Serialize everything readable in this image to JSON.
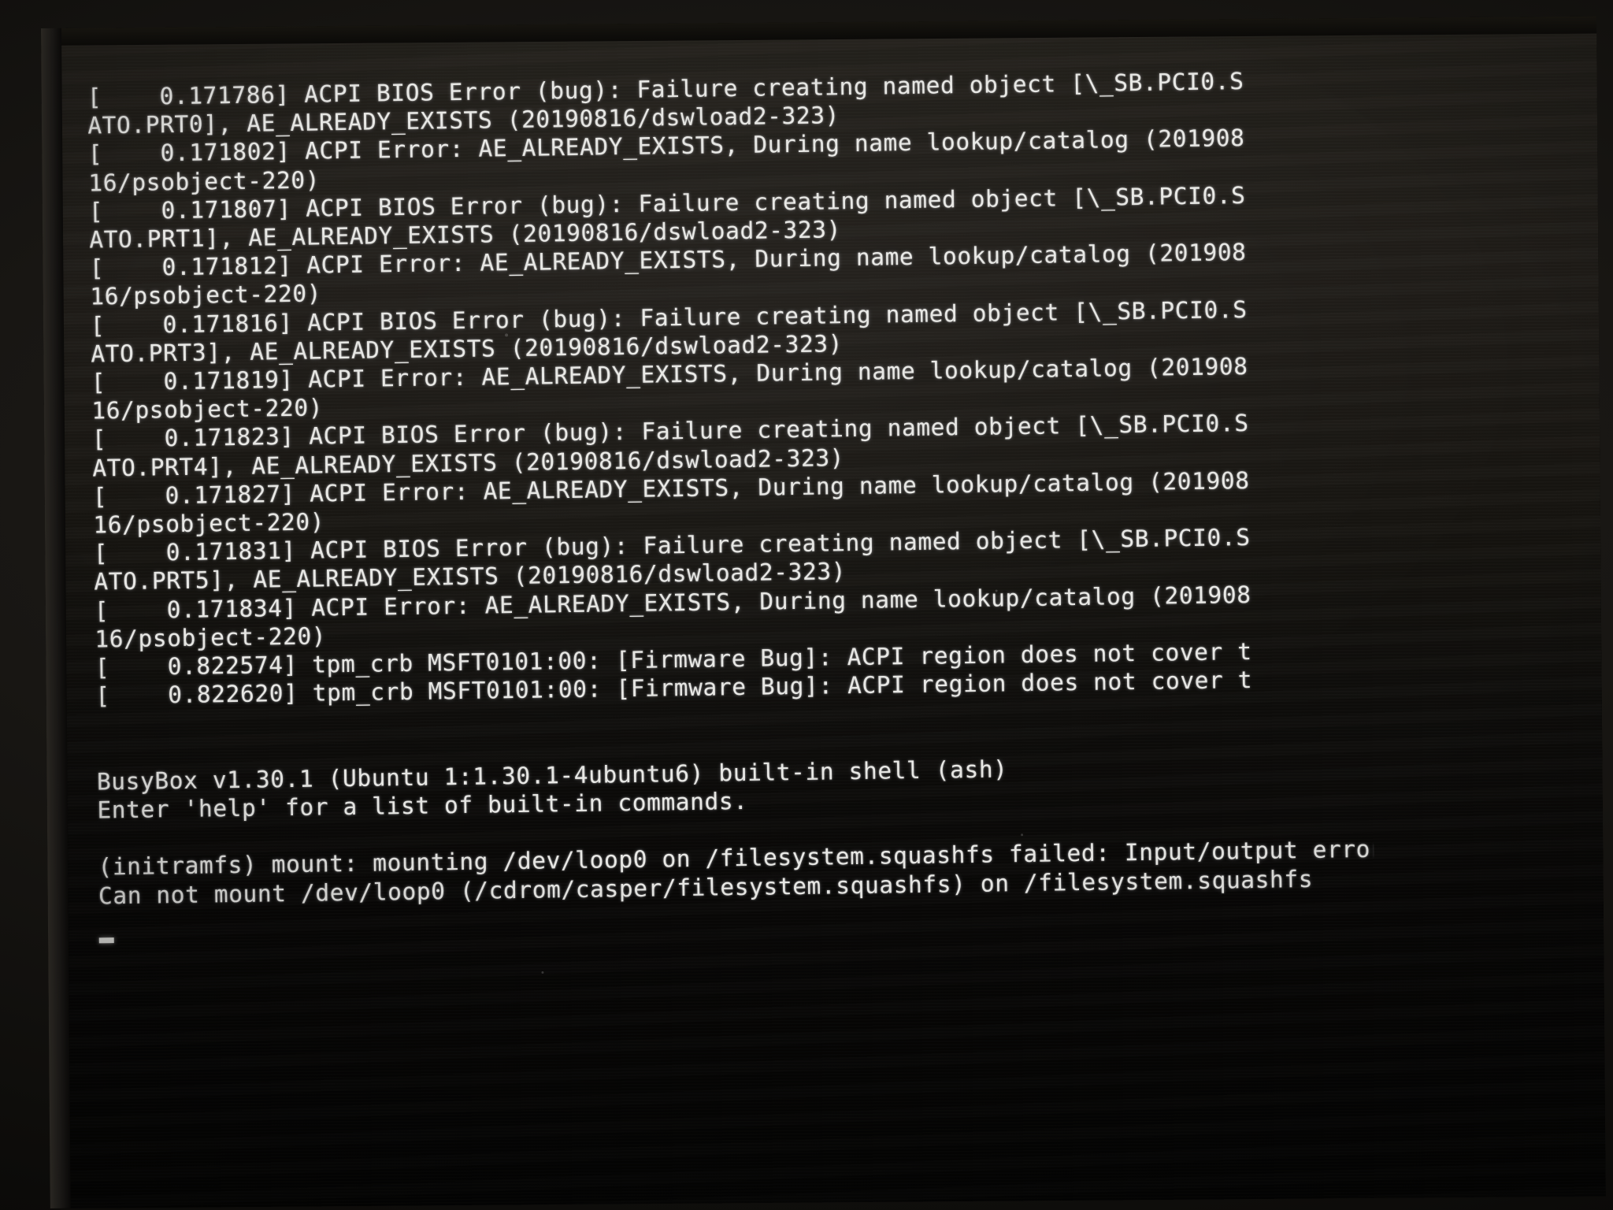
{
  "screen": {
    "type": "linux-boot-console",
    "background_color": "#0b0a08",
    "text_color": "#e9e9e6",
    "cursor_glyph": "_"
  },
  "console": {
    "lines": [
      "[    0.171786] ACPI BIOS Error (bug): Failure creating named object [\\_SB.PCI0.S",
      "ATO.PRT0], AE_ALREADY_EXISTS (20190816/dswload2-323)",
      "[    0.171802] ACPI Error: AE_ALREADY_EXISTS, During name lookup/catalog (201908",
      "16/psobject-220)",
      "[    0.171807] ACPI BIOS Error (bug): Failure creating named object [\\_SB.PCI0.S",
      "ATO.PRT1], AE_ALREADY_EXISTS (20190816/dswload2-323)",
      "[    0.171812] ACPI Error: AE_ALREADY_EXISTS, During name lookup/catalog (201908",
      "16/psobject-220)",
      "[    0.171816] ACPI BIOS Error (bug): Failure creating named object [\\_SB.PCI0.S",
      "ATO.PRT3], AE_ALREADY_EXISTS (20190816/dswload2-323)",
      "[    0.171819] ACPI Error: AE_ALREADY_EXISTS, During name lookup/catalog (201908",
      "16/psobject-220)",
      "[    0.171823] ACPI BIOS Error (bug): Failure creating named object [\\_SB.PCI0.S",
      "ATO.PRT4], AE_ALREADY_EXISTS (20190816/dswload2-323)",
      "[    0.171827] ACPI Error: AE_ALREADY_EXISTS, During name lookup/catalog (201908",
      "16/psobject-220)",
      "[    0.171831] ACPI BIOS Error (bug): Failure creating named object [\\_SB.PCI0.S",
      "ATO.PRT5], AE_ALREADY_EXISTS (20190816/dswload2-323)",
      "[    0.171834] ACPI Error: AE_ALREADY_EXISTS, During name lookup/catalog (201908",
      "16/psobject-220)",
      "[    0.822574] tpm_crb MSFT0101:00: [Firmware Bug]: ACPI region does not cover t",
      "[    0.822620] tpm_crb MSFT0101:00: [Firmware Bug]: ACPI region does not cover t",
      "",
      "",
      "BusyBox v1.30.1 (Ubuntu 1:1.30.1-4ubuntu6) built-in shell (ash)",
      "Enter 'help' for a list of built-in commands.",
      "",
      "(initramfs) mount: mounting /dev/loop0 on /filesystem.squashfs failed: Input/output error",
      "Can not mount /dev/loop0 (/cdrom/casper/filesystem.squashfs) on /filesystem.squashfs"
    ]
  },
  "details": {
    "kernel_timestamps": [
      "0.171786",
      "0.171802",
      "0.171807",
      "0.171812",
      "0.171816",
      "0.171819",
      "0.171823",
      "0.171827",
      "0.171831",
      "0.171834",
      "0.822574",
      "0.822620"
    ],
    "acpi_objects": [
      "\\_SB.PCI0.SATO.PRT0",
      "\\_SB.PCI0.SATO.PRT1",
      "\\_SB.PCI0.SATO.PRT3",
      "\\_SB.PCI0.SATO.PRT4",
      "\\_SB.PCI0.SATO.PRT5"
    ],
    "acpi_error_code": "AE_ALREADY_EXISTS",
    "acpi_ca_version": "20190816",
    "acpi_source_refs": [
      "dswload2-323",
      "psobject-220"
    ],
    "tpm_device": "tpm_crb MSFT0101:00",
    "firmware_bug_text": "[Firmware Bug]: ACPI region does not cover t",
    "busybox_version": "v1.30.1",
    "busybox_distro_package": "Ubuntu 1:1.30.1-4ubuntu6",
    "busybox_shell": "ash",
    "shell_prompt": "(initramfs)",
    "mount_source": "/dev/loop0",
    "mount_target": "/filesystem.squashfs",
    "mount_image_path": "/cdrom/casper/filesystem.squashfs",
    "mount_error": "Input/output error"
  }
}
